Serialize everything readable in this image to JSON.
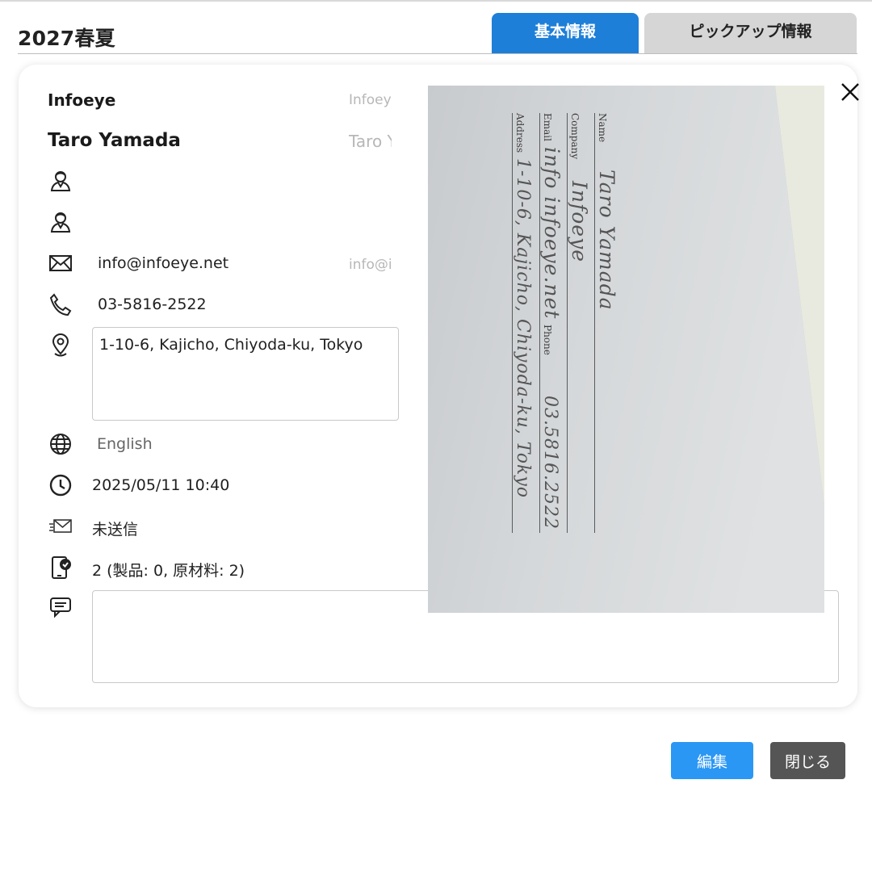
{
  "header": {
    "title": "2027春夏",
    "tabs": [
      {
        "label": "基本情報",
        "active": true
      },
      {
        "label": "ピックアップ情報",
        "active": false
      }
    ]
  },
  "contact": {
    "company": "Infoeye",
    "company_ghost": "Infoeye",
    "name": "Taro Yamada",
    "name_ghost": "Taro Yamada",
    "email": "info@infoeye.net",
    "email_ghost": "info@infoeye.net",
    "phone": "03-5816-2522",
    "address": "1-10-6, Kajicho, Chiyoda-ku, Tokyo",
    "language": "English",
    "datetime": "2025/05/11 10:40",
    "mail_status": "未送信",
    "products": "2 (製品: 0, 原材料: 2)",
    "memo": ""
  },
  "photo": {
    "labels": {
      "name": "Name",
      "company": "Company",
      "email": "Email",
      "phone": "Phone",
      "address": "Address"
    },
    "handwriting": {
      "name": "Taro Yamada",
      "company": "Infoeye",
      "email": "info infoeye.net",
      "phone": "03.5816.2522",
      "address": "1-10-6, Kajicho, Chiyoda-ku, Tokyo"
    }
  },
  "icons": {
    "person": "person-icon",
    "mail": "mail-icon",
    "phone": "phone-icon",
    "location": "location-pin-icon",
    "globe": "globe-icon",
    "clock": "clock-icon",
    "send_status": "mail-send-icon",
    "device_check": "device-check-icon",
    "memo": "chat-bubble-icon",
    "close": "close-icon"
  },
  "footer": {
    "edit_label": "編集",
    "close_label": "閉じる"
  },
  "colors": {
    "tab_active": "#1e7fd8",
    "tab_inactive": "#d6d6d6",
    "edit_button": "#2b97f4",
    "close_button": "#555555"
  }
}
